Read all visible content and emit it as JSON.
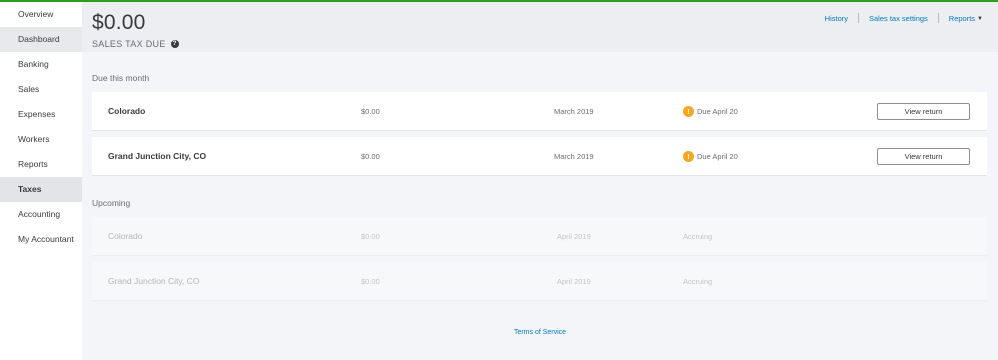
{
  "sidebar": {
    "items": [
      {
        "label": "Overview"
      },
      {
        "label": "Dashboard"
      },
      {
        "label": "Banking"
      },
      {
        "label": "Sales"
      },
      {
        "label": "Expenses"
      },
      {
        "label": "Workers"
      },
      {
        "label": "Reports"
      },
      {
        "label": "Taxes"
      },
      {
        "label": "Accounting"
      },
      {
        "label": "My Accountant"
      }
    ]
  },
  "header": {
    "amount": "$0.00",
    "label": "SALES TAX DUE",
    "help_glyph": "?",
    "links": {
      "history": "History",
      "settings": "Sales tax settings",
      "reports": "Reports"
    },
    "chevron_glyph": "▼"
  },
  "due_this_month": {
    "title": "Due this month",
    "rows": [
      {
        "name": "Colorado",
        "amount": "$0.00",
        "period": "March 2019",
        "status": "Due April 20",
        "action": "View return",
        "status_icon": "warning-icon"
      },
      {
        "name": "Grand Junction City, CO",
        "amount": "$0.00",
        "period": "March 2019",
        "status": "Due April 20",
        "action": "View return",
        "status_icon": "warning-icon"
      }
    ],
    "warn_glyph": "!"
  },
  "upcoming": {
    "title": "Upcoming",
    "rows": [
      {
        "name": "Colorado",
        "amount": "$0.00",
        "period": "April 2019",
        "status": "Accruing"
      },
      {
        "name": "Grand Junction City, CO",
        "amount": "$0.00",
        "period": "April 2019",
        "status": "Accruing"
      }
    ]
  },
  "footer": {
    "terms": "Terms of Service"
  },
  "colors": {
    "accent": "#0077c5",
    "brand_green": "#2ca01c",
    "warning": "#f5a623"
  }
}
